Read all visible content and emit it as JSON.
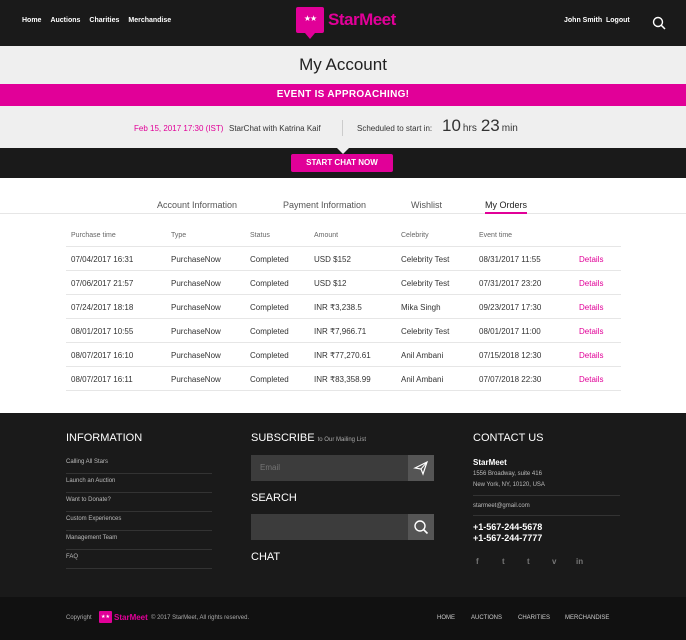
{
  "nav": {
    "links": [
      "Home",
      "Auctions",
      "Charities",
      "Merchandise"
    ],
    "logo_stars": "★★",
    "logo_text": "StarMeet",
    "user": "John Smith",
    "logout": "Logout",
    "search_icon": "search-icon"
  },
  "page": {
    "title": "My Account"
  },
  "event": {
    "banner": "EVENT IS APPROACHING!",
    "date": "Feb 15, 2017 17:30 (IST)",
    "title": "StarChat with Katrina Kaif",
    "scheduled_label": "Scheduled to start in:",
    "hours": "10",
    "hours_unit": "hrs",
    "minutes": "23",
    "minutes_unit": "min",
    "button": "START CHAT NOW"
  },
  "tabs": [
    "Account Information",
    "Payment Information",
    "Wishlist",
    "My Orders"
  ],
  "orders": {
    "headers": [
      "Purchase time",
      "Type",
      "Status",
      "Amount",
      "Celebrity",
      "Event time"
    ],
    "rows": [
      {
        "time": "07/04/2017 16:31",
        "type": "PurchaseNow",
        "status": "Completed",
        "amount": "USD $152",
        "celebrity": "Celebrity Test",
        "event_time": "08/31/2017 11:55",
        "link": "Details"
      },
      {
        "time": "07/06/2017 21:57",
        "type": "PurchaseNow",
        "status": "Completed",
        "amount": "USD $12",
        "celebrity": "Celebrity Test",
        "event_time": "07/31/2017 23:20",
        "link": "Details"
      },
      {
        "time": "07/24/2017 18:18",
        "type": "PurchaseNow",
        "status": "Completed",
        "amount": "INR ₹3,238.5",
        "celebrity": "Mika Singh",
        "event_time": "09/23/2017 17:30",
        "link": "Details"
      },
      {
        "time": "08/01/2017 10:55",
        "type": "PurchaseNow",
        "status": "Completed",
        "amount": "INR ₹7,966.71",
        "celebrity": "Celebrity Test",
        "event_time": "08/01/2017 11:00",
        "link": "Details"
      },
      {
        "time": "08/07/2017 16:10",
        "type": "PurchaseNow",
        "status": "Completed",
        "amount": "INR ₹77,270.61",
        "celebrity": "Anil Ambani",
        "event_time": "07/15/2018 12:30",
        "link": "Details"
      },
      {
        "time": "08/07/2017 16:11",
        "type": "PurchaseNow",
        "status": "Completed",
        "amount": "INR ₹83,358.99",
        "celebrity": "Anil Ambani",
        "event_time": "07/07/2018 22:30",
        "link": "Details"
      }
    ]
  },
  "footer": {
    "info_title": "INFORMATION",
    "info_links": [
      "Calling All Stars",
      "Launch an Auction",
      "Want to Donate?",
      "Custom Experiences",
      "Management Team",
      "FAQ"
    ],
    "subscribe_title": "SUBSCRIBE",
    "subscribe_sub": "to Our Mailing List",
    "email_placeholder": "Email",
    "search_title": "SEARCH",
    "chat_title": "CHAT",
    "contact_title": "CONTACT US",
    "company": "StarMeet",
    "address1": "1556 Broadway, suite 416",
    "address2": "New York, NY, 10120, USA",
    "email": "starmeet@gmail.com",
    "phone1": "+1-567-244-5678",
    "phone2": "+1-567-244-7777",
    "social": [
      "f",
      "t",
      "t",
      "v",
      "in"
    ],
    "copyright_prefix": "Copyright",
    "copyright": "© 2017 StarMeet, All rights reserved.",
    "bottom_links": [
      "HOME",
      "AUCTIONS",
      "CHARITIES",
      "MERCHANDISE"
    ]
  },
  "colors": {
    "accent": "#e10098",
    "dark": "#1a1a1a",
    "light": "#efefef"
  }
}
